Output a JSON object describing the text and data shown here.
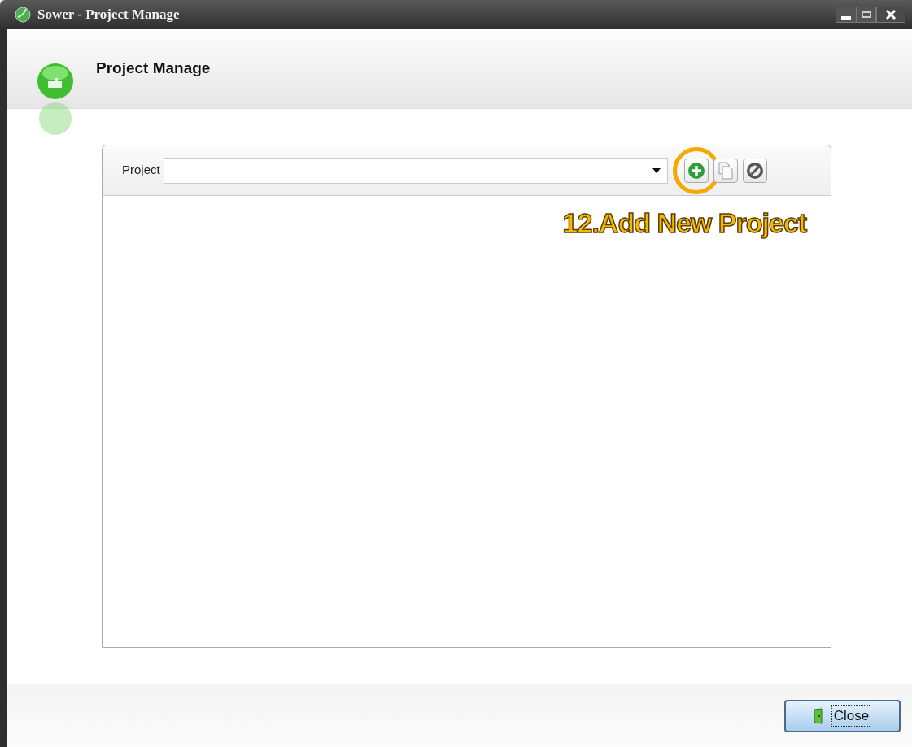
{
  "window": {
    "title": "Sower - Project Manage"
  },
  "header": {
    "title": "Project Manage"
  },
  "toolbar": {
    "label": "Project",
    "buttons": [
      {
        "kind": "add",
        "highlighted": true
      },
      {
        "kind": "copy",
        "highlighted": false
      },
      {
        "kind": "delete",
        "highlighted": false
      }
    ]
  },
  "annotation": {
    "text": "12.Add New Project"
  },
  "footer": {
    "close_button": "Close"
  }
}
